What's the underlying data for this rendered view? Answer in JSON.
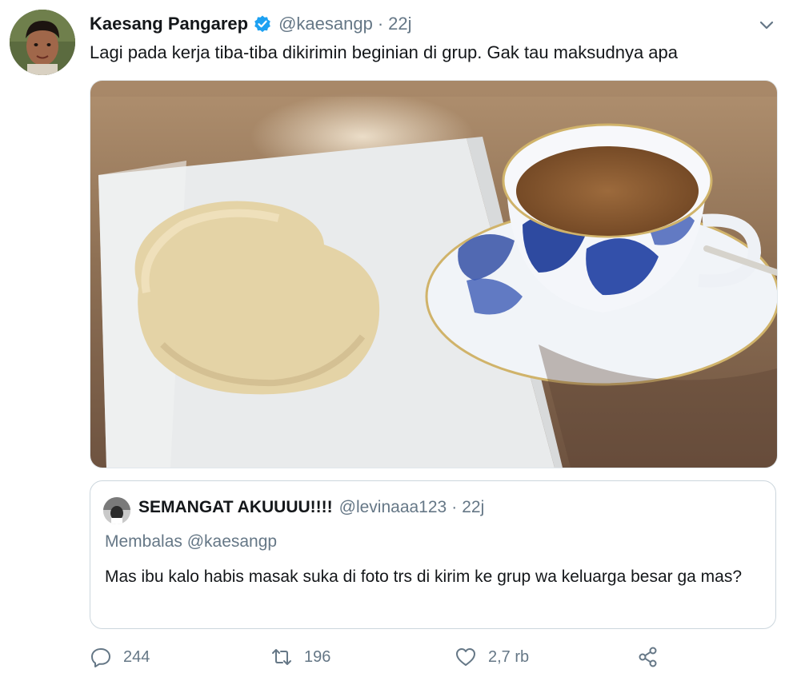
{
  "tweet": {
    "author_name": "Kaesang Pangarep",
    "handle": "@kaesangp",
    "separator": "·",
    "time": "22j",
    "text": "Lagi pada kerja tiba-tiba dikirimin beginian di grup. Gak tau maksudnya apa"
  },
  "quote": {
    "author_name": "SEMANGAT AKUUUU!!!!",
    "handle": "@levinaaa123",
    "separator": "·",
    "time": "22j",
    "reply_to": "Membalas @kaesangp",
    "text": "Mas ibu kalo habis masak suka di foto trs di kirim ke grup wa keluarga besar ga mas?"
  },
  "actions": {
    "replies": "244",
    "retweets": "196",
    "likes": "2,7 rb"
  },
  "icons": {
    "verified": "verified-badge-icon",
    "chevron": "chevron-down-icon",
    "reply": "reply-icon",
    "retweet": "retweet-icon",
    "like": "heart-icon",
    "share": "share-icon"
  },
  "colors": {
    "text_primary": "#14171a",
    "text_secondary": "#657786",
    "verified": "#1da1f2",
    "border": "#ccd6dd"
  }
}
